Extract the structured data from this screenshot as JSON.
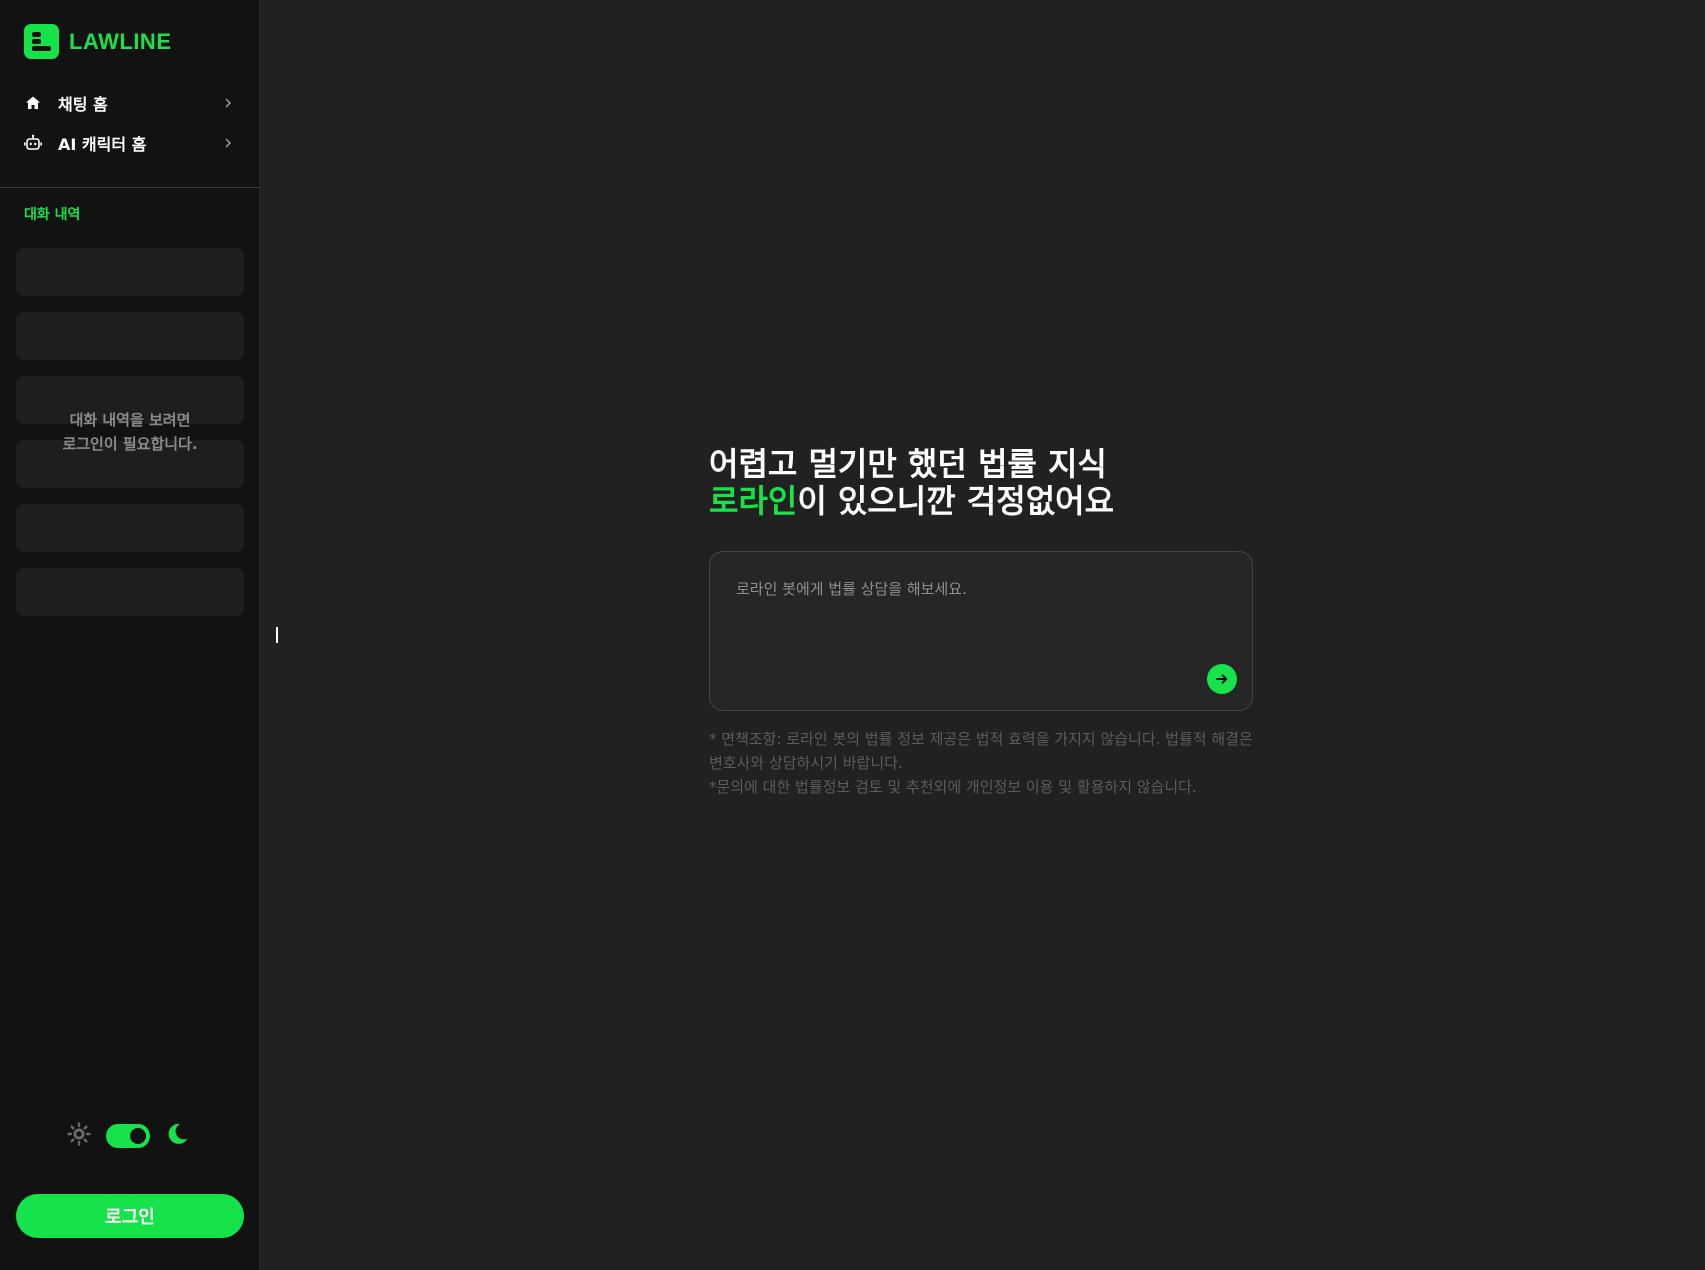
{
  "brand": {
    "name": "LAWLINE",
    "color": "#16e24a"
  },
  "nav": [
    {
      "label": "채팅 홈",
      "icon": "home-icon"
    },
    {
      "label": "AI 캐릭터 홈",
      "icon": "robot-icon"
    }
  ],
  "history": {
    "title": "대화 내역",
    "login_notice": "대화 내역을 보려면\n로그인이 필요합니다."
  },
  "theme": {
    "mode": "dark",
    "dark_enabled": true
  },
  "login_button": "로그인",
  "hero": {
    "line1": "어렵고 멀기만 했던 법률 지식",
    "line2_accent": "로라인",
    "line2_rest": "이 있으니깐 걱정없어요"
  },
  "chat": {
    "placeholder": "로라인 봇에게 법률 상담을 해보세요.",
    "value": ""
  },
  "disclaimer": [
    "* 면책조항: 로라인 봇의 법률 정보 제공은 법적 효력을 가지지 않습니다. 법률적 해결은 변호사와 상담하시기 바랍니다.",
    "*문의에 대한 법률정보 검토 및 추천외에 개인정보 이용 및 활용하지 않습니다."
  ]
}
